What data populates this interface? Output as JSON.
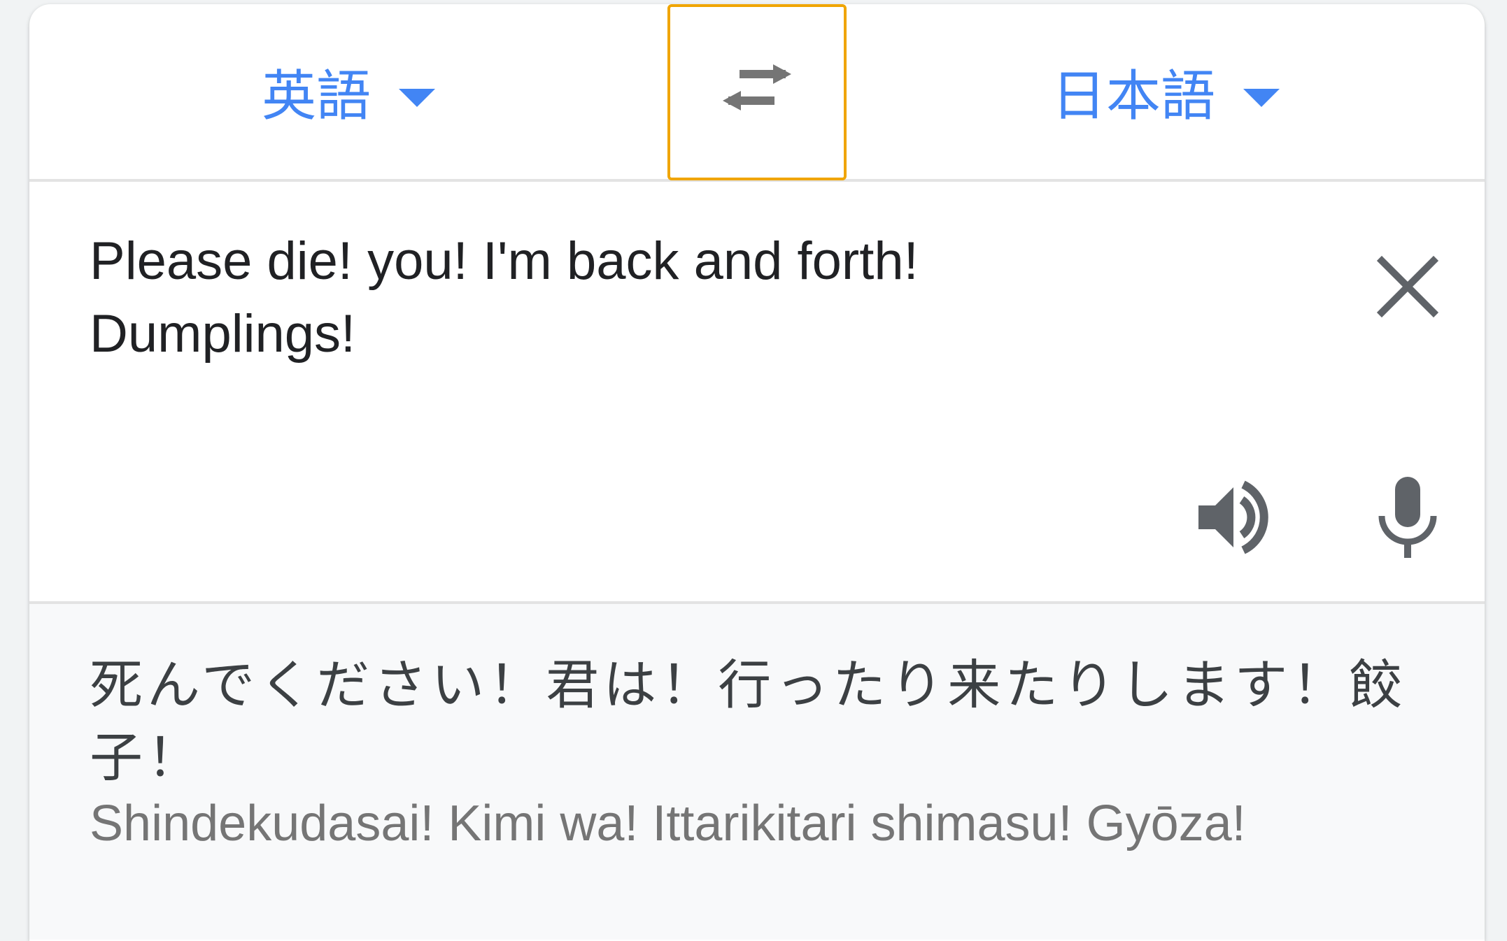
{
  "language_bar": {
    "source_language": "英語",
    "target_language": "日本語",
    "swap_icon": "swap-arrows-icon",
    "dropdown_icon": "caret-down-icon",
    "accent_color": "#4285f4",
    "focus_color": "#f0a500"
  },
  "input": {
    "text": "Please die! you! I'm back and forth!\nDumplings!",
    "clear_icon": "close-icon",
    "speaker_icon": "speaker-icon",
    "mic_icon": "microphone-icon"
  },
  "output": {
    "translation": "死んでください！君は！行ったり来たりします！餃子！",
    "romanization": "Shindekudasai! Kimi wa! Ittarikitari shimasu! Gyōza!"
  }
}
